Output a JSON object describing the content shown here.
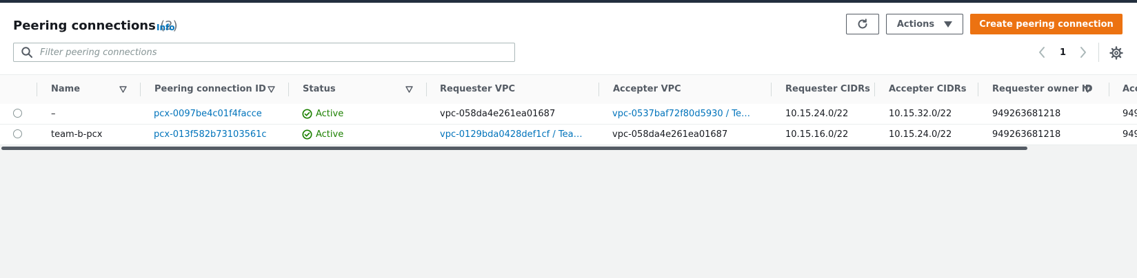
{
  "header": {
    "title": "Peering connections",
    "count": "(2)",
    "info_label": "Info",
    "actions_label": "Actions",
    "create_label": "Create peering connection"
  },
  "search": {
    "placeholder": "Filter peering connections",
    "value": ""
  },
  "pagination": {
    "current_page": "1"
  },
  "icons": {
    "refresh": "refresh-icon",
    "search": "search-icon",
    "prev": "chevron-left-icon",
    "next": "chevron-right-icon",
    "settings": "gear-icon",
    "sort": "sort-down-icon",
    "status": "check-circle-icon"
  },
  "colors": {
    "primary": "#ec7211",
    "link": "#0073bb",
    "success": "#1d8102"
  },
  "table": {
    "columns": [
      "Name",
      "Peering connection ID",
      "Status",
      "Requester VPC",
      "Accepter VPC",
      "Requester CIDRs",
      "Accepter CIDRs",
      "Requester owner ID",
      "Acc"
    ],
    "rows": [
      {
        "name": "–",
        "id": "pcx-0097be4c01f4facce",
        "status": "Active",
        "requester_vpc": "vpc-058da4e261ea01687",
        "accepter_vpc": "vpc-0537baf72f80d5930 / Te…",
        "requester_cidrs": "10.15.24.0/22",
        "accepter_cidrs": "10.15.32.0/22",
        "requester_owner": "949263681218",
        "accepter_owner": "949"
      },
      {
        "name": "team-b-pcx",
        "id": "pcx-013f582b73103561c",
        "status": "Active",
        "requester_vpc": "vpc-0129bda0428def1cf / Tea…",
        "accepter_vpc": "vpc-058da4e261ea01687",
        "requester_cidrs": "10.15.16.0/22",
        "accepter_cidrs": "10.15.24.0/22",
        "requester_owner": "949263681218",
        "accepter_owner": "949"
      }
    ]
  }
}
